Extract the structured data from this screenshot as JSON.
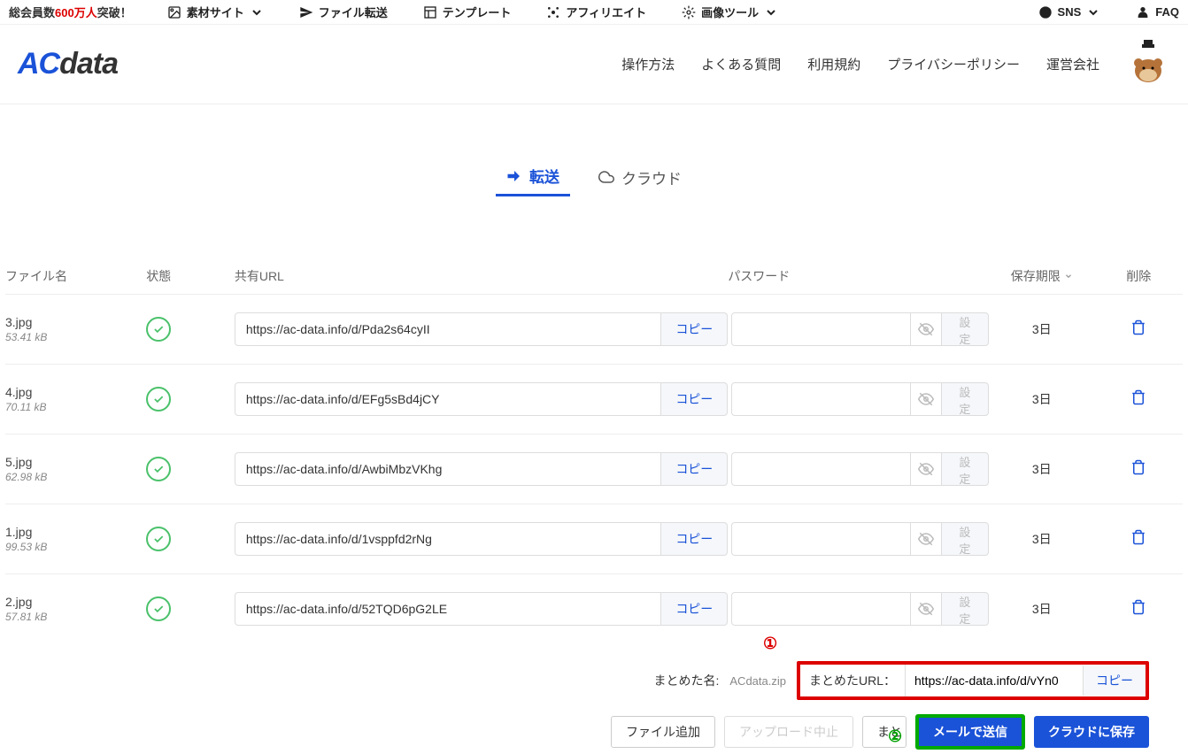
{
  "topBar": {
    "memberPrefix": "総会員数",
    "memberCount": "600万人",
    "memberSuffix": "突破！",
    "items": {
      "material": "素材サイト",
      "transfer": "ファイル転送",
      "template": "テンプレート",
      "affiliate": "アフィリエイト",
      "imageTool": "画像ツール",
      "sns": "SNS",
      "faq": "FAQ"
    }
  },
  "logo": {
    "ac": "AC",
    "data": "data"
  },
  "nav": {
    "howto": "操作方法",
    "faq": "よくある質問",
    "terms": "利用規約",
    "privacy": "プライバシーポリシー",
    "company": "運営会社"
  },
  "tabs": {
    "transfer": "転送",
    "cloud": "クラウド"
  },
  "tableHeaders": {
    "filename": "ファイル名",
    "status": "状態",
    "url": "共有URL",
    "password": "パスワード",
    "retention": "保存期限",
    "delete": "削除"
  },
  "files": [
    {
      "name": "3.jpg",
      "size": "53.41 kB",
      "url": "https://ac-data.info/d/Pda2s64cyII",
      "retention": "3日"
    },
    {
      "name": "4.jpg",
      "size": "70.11 kB",
      "url": "https://ac-data.info/d/EFg5sBd4jCY",
      "retention": "3日"
    },
    {
      "name": "5.jpg",
      "size": "62.98 kB",
      "url": "https://ac-data.info/d/AwbiMbzVKhg",
      "retention": "3日"
    },
    {
      "name": "1.jpg",
      "size": "99.53 kB",
      "url": "https://ac-data.info/d/1vsppfd2rNg",
      "retention": "3日"
    },
    {
      "name": "2.jpg",
      "size": "57.81 kB",
      "url": "https://ac-data.info/d/52TQD6pG2LE",
      "retention": "3日"
    }
  ],
  "copyLabel": "コピー",
  "setLabel": "設定",
  "summary": {
    "nameLabel": "まとめた名:",
    "nameValue": "ACdata.zip",
    "urlLabel": "まとめたURL：",
    "urlValue": "https://ac-data.info/d/vYn0"
  },
  "annotations": {
    "one": "①",
    "two": "②"
  },
  "buttons": {
    "addFile": "ファイル追加",
    "uploadStop": "アップロード中止",
    "combine": "まと",
    "sendMail": "メールで送信",
    "saveCloud": "クラウドに保存"
  }
}
